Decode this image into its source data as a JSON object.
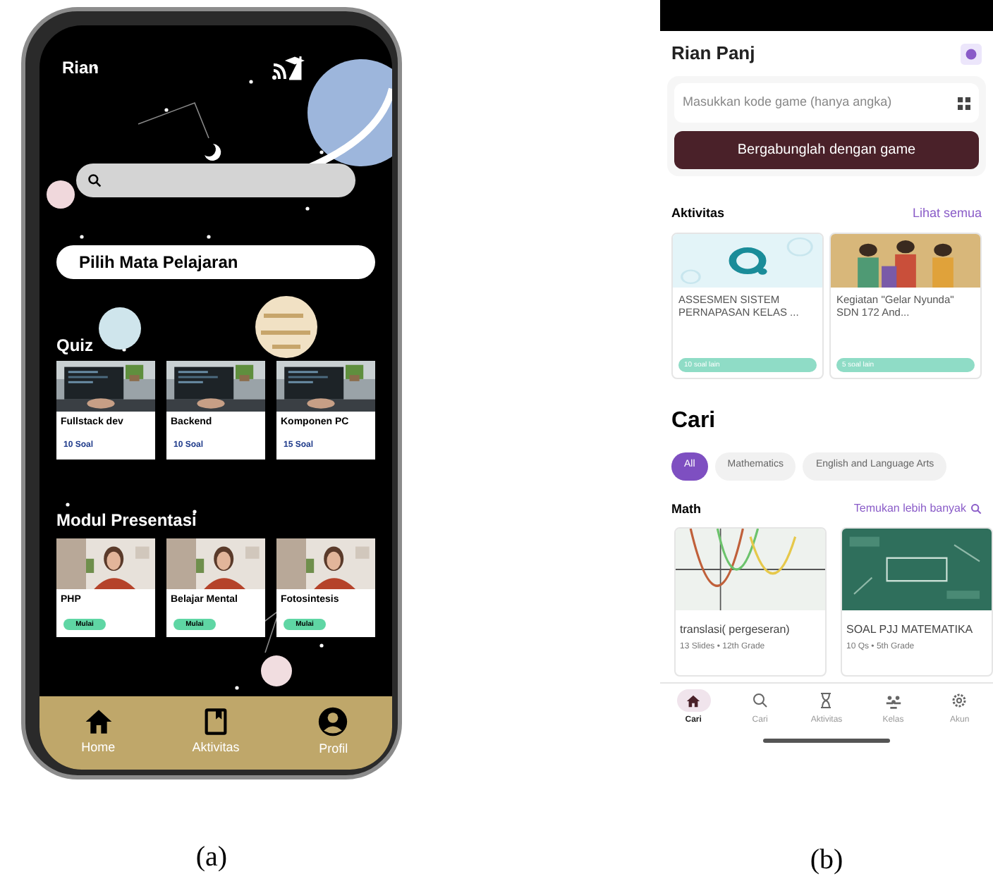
{
  "panel_a": {
    "caption": "(a)",
    "user_name": "Rian",
    "subject_picker": {
      "label": "Pilih Mata Pelajaran"
    },
    "quiz": {
      "title": "Quiz",
      "cards": [
        {
          "title": "Fullstack dev",
          "count": "10 Soal"
        },
        {
          "title": "Backend",
          "count": "10 Soal"
        },
        {
          "title": "Komponen PC",
          "count": "15 Soal"
        }
      ]
    },
    "modules": {
      "title": "Modul Presentasi",
      "cards": [
        {
          "title": "PHP",
          "button": "Mulai"
        },
        {
          "title": "Belajar Mental",
          "button": "Mulai"
        },
        {
          "title": "Fotosintesis",
          "button": "Mulai"
        }
      ]
    },
    "nav": [
      {
        "label": "Home",
        "kind": "home"
      },
      {
        "label": "Aktivitas",
        "kind": "book"
      },
      {
        "label": "Profil",
        "kind": "user"
      }
    ]
  },
  "panel_b": {
    "caption": "(b)",
    "user_name": "Rian Panj",
    "game_code": {
      "placeholder": "Masukkan kode game (hanya angka)"
    },
    "join_button": "Bergabunglah dengan game",
    "activities": {
      "title": "Aktivitas",
      "see_all": "Lihat semua",
      "cards": [
        {
          "title": "ASSESMEN SISTEM PERNAPASAN KELAS ...",
          "badge": "10 soal lain",
          "kind": "logo"
        },
        {
          "title": "Kegiatan \"Gelar Nyunda\" SDN 172 And...",
          "badge": "5 soal lain",
          "kind": "crowd"
        }
      ]
    },
    "search_title": "Cari",
    "chips": [
      {
        "label": "All",
        "selected": true
      },
      {
        "label": "Mathematics",
        "selected": false
      },
      {
        "label": "English and Language Arts",
        "selected": false
      }
    ],
    "math": {
      "title": "Math",
      "more": "Temukan lebih banyak",
      "cards": [
        {
          "title": "translasi( pergeseran)",
          "meta": "13 Slides • 12th Grade",
          "kind": "graph"
        },
        {
          "title": "SOAL PJJ MATEMATIKA",
          "meta": "10 Qs • 5th Grade",
          "kind": "board"
        }
      ]
    },
    "nav": [
      {
        "label": "Cari",
        "kind": "home",
        "selected": true
      },
      {
        "label": "Cari",
        "kind": "search",
        "selected": false
      },
      {
        "label": "Aktivitas",
        "kind": "hourglass",
        "selected": false
      },
      {
        "label": "Kelas",
        "kind": "people",
        "selected": false
      },
      {
        "label": "Akun",
        "kind": "gear",
        "selected": false
      }
    ]
  }
}
